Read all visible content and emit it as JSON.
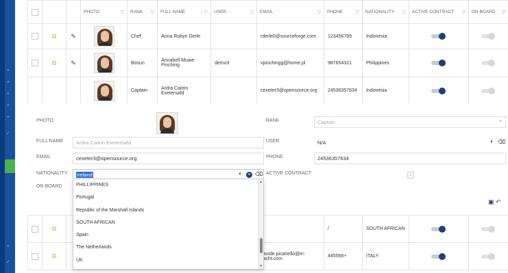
{
  "columns": {
    "photo": "PHOTO",
    "rank": "RANK",
    "full_name": "FULL NAME",
    "user": "USER",
    "email": "EMAIL",
    "phone": "PHONE",
    "nationality": "NATIONALITY",
    "active_contract": "ACTIVE CONTRACT",
    "on_board": "ON BOARD"
  },
  "rows": [
    {
      "rank": "Chef",
      "full_name": "Anna Robyn Derle",
      "user": "",
      "email": "rderle0@sourceforge.com",
      "phone": "123456789",
      "nationality": "Indonesia",
      "active_contract": true,
      "on_board": false
    },
    {
      "rank": "Bosun",
      "full_name": "Annabell Muaie Pinching",
      "user": "demo3",
      "email": "vpinchingg@home.pl",
      "phone": "987654321",
      "nationality": "Philippines",
      "active_contract": true,
      "on_board": false
    },
    {
      "rank": "Captain",
      "full_name": "Ardra Caitrin Exetersafd",
      "user": "",
      "email": "cexeter3@opensource.org",
      "phone": "24536357634",
      "nationality": "Indonesia",
      "active_contract": true,
      "on_board": false
    }
  ],
  "rows_below": [
    {
      "email": "",
      "phone": "/",
      "nationality": "SOUTH AFRICAN",
      "active_contract": true,
      "on_board": false
    },
    {
      "email": "davide.picariello@in-yacht.com",
      "phone": "445566+",
      "nationality": "ITALY",
      "active_contract": true,
      "on_board": false
    }
  ],
  "form": {
    "photo_label": "PHOTO",
    "full_name_label": "FULL NAME",
    "full_name_placeholder": "Ardra Caitrin Exetersafd",
    "email_label": "EMAIL",
    "email_value": "cexeter3@opensource.org",
    "nationality_label": "NATIONALITY",
    "nationality_value": "Ireland",
    "on_board_label": "ON BOARD",
    "rank_label": "RANK",
    "rank_placeholder": "Captain",
    "user_label": "USER",
    "user_value": "N/A",
    "phone_label": "PHONE",
    "phone_value": "24536357634",
    "active_contract_label": "ACTIVE CONTRACT",
    "active_contract_checked": true
  },
  "nationality_options": [
    "PHILLIPPINES",
    "Portugal",
    "Republic of the Marshall Islands",
    "SOUTH AFRICAN",
    "Spain",
    "The Netherlands",
    "UK"
  ],
  "colors": {
    "sidebar": "#0b3a7e",
    "accent": "#1d3f7a",
    "active_nav": "#4caf50",
    "edit_icon": "#e6a23c"
  }
}
